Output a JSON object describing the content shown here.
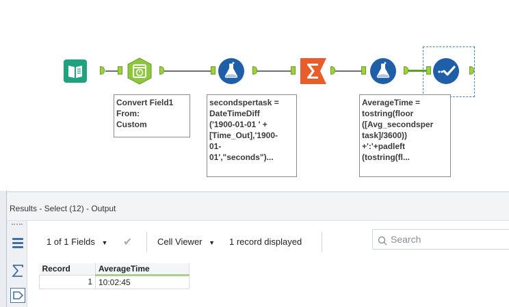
{
  "canvas": {
    "annotations": {
      "datetime": [
        "Convert Field1",
        "From:",
        "Custom"
      ],
      "formula1": [
        "secondspertask =",
        "DateTimeDiff",
        "('1900-01-01 ' +",
        "[Time_Out],'1900-",
        "01-",
        "01',\"seconds\")..."
      ],
      "formula2": [
        "AverageTime =",
        "tostring(floor",
        "([Avg_secondsper",
        "task]/3600))",
        "+':'+padleft",
        "(tostring(fl..."
      ]
    },
    "colors": {
      "input_tool": "#1fa37f",
      "datetime_tool": "#8dc63f",
      "formula_tool": "#1f5fa8",
      "summarize_tool": "#e85d2a",
      "select_tool": "#1f5fa8",
      "anchor": "#9bd23c"
    }
  },
  "results": {
    "title": "Results - Select (12) - Output",
    "fields_label": "1 of 1 Fields",
    "viewer_label": "Cell Viewer",
    "records_label": "1 record displayed",
    "search_placeholder": "Search",
    "columns": [
      "Record",
      "AverageTime"
    ],
    "rows": [
      {
        "record": "1",
        "average_time": "10:02:45"
      }
    ]
  }
}
